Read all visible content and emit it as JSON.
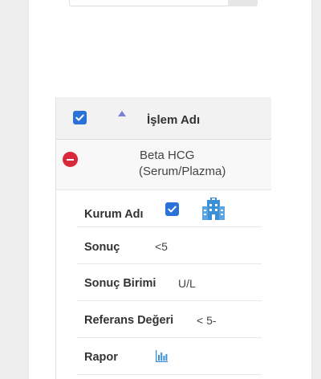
{
  "table": {
    "header": {
      "column_label": "İşlem Adı"
    },
    "row": {
      "name_line1": "Beta HCG",
      "name_line2": "(Serum/Plazma)"
    },
    "details": {
      "institution": {
        "label": "Kurum Adı"
      },
      "result": {
        "label": "Sonuç",
        "value": "<5"
      },
      "unit": {
        "label": "Sonuç Birimi",
        "value": "U/L"
      },
      "reference": {
        "label": "Referans Değeri",
        "value": "< 5-"
      },
      "report": {
        "label": "Rapor"
      }
    }
  },
  "colors": {
    "checkbox": "#2a72d8",
    "remove": "#d9283a",
    "sort_arrow": "#7a7fd8",
    "icon_blue": "#3b8fd6"
  },
  "icons": [
    "sort-arrow-up-icon",
    "remove-icon",
    "building-icon",
    "bar-chart-icon",
    "check-icon"
  ]
}
